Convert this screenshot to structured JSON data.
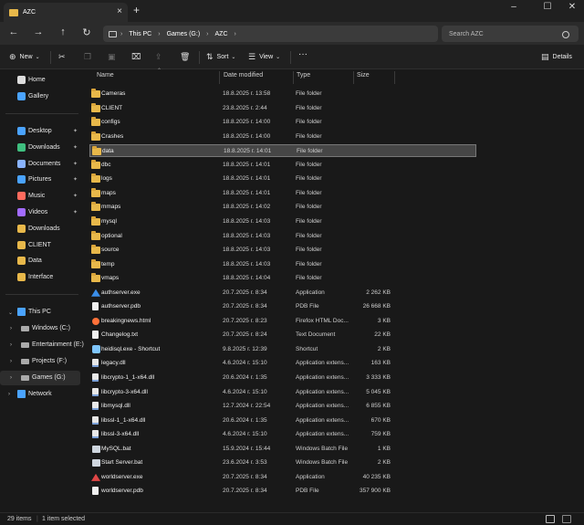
{
  "window": {
    "tab_title": "AZC",
    "new_tab": "+",
    "close_tab": "×",
    "minimize": "–",
    "maximize": "☐",
    "close": "✕"
  },
  "nav": {
    "back": "←",
    "forward": "→",
    "up": "↑",
    "refresh": "↻",
    "breadcrumb": [
      "This PC",
      "Games (G:)",
      "AZC"
    ],
    "breadcrumb_more": "›",
    "search_placeholder": "Search AZC"
  },
  "toolbar": {
    "new_label": "New",
    "sort_label": "Sort",
    "view_label": "View",
    "more_label": "···",
    "details_label": "Details"
  },
  "sidebar": {
    "quick": [
      {
        "label": "Home",
        "icon": "home-icon"
      },
      {
        "label": "Gallery",
        "icon": "gallery-icon"
      }
    ],
    "pinned": [
      {
        "label": "Desktop",
        "icon": "desktop-icon",
        "pinned": true
      },
      {
        "label": "Downloads",
        "icon": "downloads-icon",
        "pinned": true
      },
      {
        "label": "Documents",
        "icon": "documents-icon",
        "pinned": true
      },
      {
        "label": "Pictures",
        "icon": "pictures-icon",
        "pinned": true
      },
      {
        "label": "Music",
        "icon": "music-icon",
        "pinned": true
      },
      {
        "label": "Videos",
        "icon": "videos-icon",
        "pinned": true
      },
      {
        "label": "Downloads",
        "icon": "folder-icon",
        "pinned": false
      },
      {
        "label": "CLIENT",
        "icon": "folder-icon",
        "pinned": false
      },
      {
        "label": "Data",
        "icon": "folder-icon",
        "pinned": false
      },
      {
        "label": "Interface",
        "icon": "folder-icon",
        "pinned": false
      }
    ],
    "this_pc": "This PC",
    "drives": [
      {
        "label": "Windows (C:)"
      },
      {
        "label": "Entertainment (E:)"
      },
      {
        "label": "Projects (F:)"
      },
      {
        "label": "Games (G:)",
        "selected": true
      }
    ],
    "network": "Network"
  },
  "columns": {
    "name": "Name",
    "date": "Date modified",
    "type": "Type",
    "size": "Size"
  },
  "files": [
    {
      "name": "Cameras",
      "date": "18.8.2025 г. 13:58",
      "type": "File folder",
      "size": "",
      "kind": "folder"
    },
    {
      "name": "CLIENT",
      "date": "23.8.2025 г. 2:44",
      "type": "File folder",
      "size": "",
      "kind": "folder"
    },
    {
      "name": "configs",
      "date": "18.8.2025 г. 14:00",
      "type": "File folder",
      "size": "",
      "kind": "folder"
    },
    {
      "name": "Crashes",
      "date": "18.8.2025 г. 14:00",
      "type": "File folder",
      "size": "",
      "kind": "folder"
    },
    {
      "name": "data",
      "date": "18.8.2025 г. 14:01",
      "type": "File folder",
      "size": "",
      "kind": "folder",
      "selected": true
    },
    {
      "name": "dbc",
      "date": "18.8.2025 г. 14:01",
      "type": "File folder",
      "size": "",
      "kind": "folder"
    },
    {
      "name": "logs",
      "date": "18.8.2025 г. 14:01",
      "type": "File folder",
      "size": "",
      "kind": "folder"
    },
    {
      "name": "maps",
      "date": "18.8.2025 г. 14:01",
      "type": "File folder",
      "size": "",
      "kind": "folder"
    },
    {
      "name": "mmaps",
      "date": "18.8.2025 г. 14:02",
      "type": "File folder",
      "size": "",
      "kind": "folder"
    },
    {
      "name": "mysql",
      "date": "18.8.2025 г. 14:03",
      "type": "File folder",
      "size": "",
      "kind": "folder"
    },
    {
      "name": "optional",
      "date": "18.8.2025 г. 14:03",
      "type": "File folder",
      "size": "",
      "kind": "folder"
    },
    {
      "name": "source",
      "date": "18.8.2025 г. 14:03",
      "type": "File folder",
      "size": "",
      "kind": "folder"
    },
    {
      "name": "temp",
      "date": "18.8.2025 г. 14:03",
      "type": "File folder",
      "size": "",
      "kind": "folder"
    },
    {
      "name": "vmaps",
      "date": "18.8.2025 г. 14:04",
      "type": "File folder",
      "size": "",
      "kind": "folder"
    },
    {
      "name": "authserver.exe",
      "date": "20.7.2025 г. 8:34",
      "type": "Application",
      "size": "2 262 KB",
      "kind": "exe-blue"
    },
    {
      "name": "authserver.pdb",
      "date": "20.7.2025 г. 8:34",
      "type": "PDB File",
      "size": "26 668 KB",
      "kind": "file"
    },
    {
      "name": "breakingnews.html",
      "date": "20.7.2025 г. 8:23",
      "type": "Firefox HTML Doc...",
      "size": "3 KB",
      "kind": "html"
    },
    {
      "name": "Changelog.txt",
      "date": "20.7.2025 г. 8:24",
      "type": "Text Document",
      "size": "22 KB",
      "kind": "file"
    },
    {
      "name": "heidisql.exe - Shortcut",
      "date": "9.8.2025 г. 12:39",
      "type": "Shortcut",
      "size": "2 KB",
      "kind": "shortcut"
    },
    {
      "name": "legacy.dll",
      "date": "4.6.2024 г. 15:10",
      "type": "Application extens...",
      "size": "163 KB",
      "kind": "dll"
    },
    {
      "name": "libcrypto-1_1-x64.dll",
      "date": "20.6.2024 г. 1:35",
      "type": "Application extens...",
      "size": "3 333 KB",
      "kind": "dll"
    },
    {
      "name": "libcrypto-3-x64.dll",
      "date": "4.6.2024 г. 15:10",
      "type": "Application extens...",
      "size": "5 045 KB",
      "kind": "dll"
    },
    {
      "name": "libmysql.dll",
      "date": "12.7.2024 г. 22:54",
      "type": "Application extens...",
      "size": "6 855 KB",
      "kind": "dll"
    },
    {
      "name": "libssl-1_1-x64.dll",
      "date": "20.6.2024 г. 1:35",
      "type": "Application extens...",
      "size": "670 KB",
      "kind": "dll"
    },
    {
      "name": "libssl-3-x64.dll",
      "date": "4.6.2024 г. 15:10",
      "type": "Application extens...",
      "size": "759 KB",
      "kind": "dll"
    },
    {
      "name": "MySQL.bat",
      "date": "15.9.2024 г. 15:44",
      "type": "Windows Batch File",
      "size": "1 KB",
      "kind": "bat"
    },
    {
      "name": "Start Server.bat",
      "date": "23.6.2024 г. 3:53",
      "type": "Windows Batch File",
      "size": "2 KB",
      "kind": "bat"
    },
    {
      "name": "worldserver.exe",
      "date": "20.7.2025 г. 8:34",
      "type": "Application",
      "size": "40 235 KB",
      "kind": "exe-red"
    },
    {
      "name": "worldserver.pdb",
      "date": "20.7.2025 г. 8:34",
      "type": "PDB File",
      "size": "357 900 KB",
      "kind": "file"
    }
  ],
  "status": {
    "items": "29 items",
    "selected": "1 item selected"
  },
  "colors": {
    "folder": "#e8b84a",
    "accent": "#4aa3ff",
    "bg": "#191919"
  }
}
